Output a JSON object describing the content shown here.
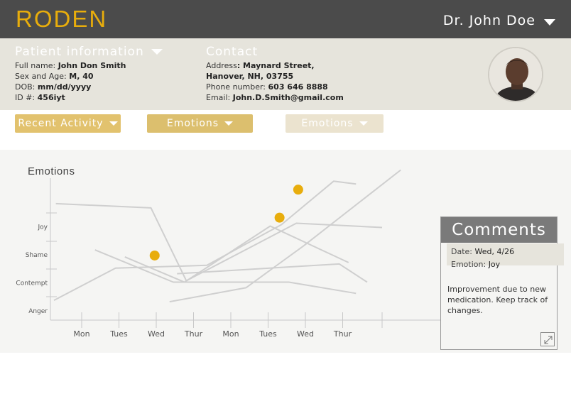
{
  "header": {
    "logo": "RODEN",
    "user_name": "Dr. John Doe"
  },
  "patient": {
    "section_title": "Patient information",
    "full_name_label": "Full name:",
    "full_name": "John Don Smith",
    "sex_age_label": "Sex and Age:",
    "sex_age": "M, 40",
    "dob_label": "DOB:",
    "dob": "mm/dd/yyyy",
    "id_label": "ID #:",
    "id": "456iyt"
  },
  "contact": {
    "section_title": "Contact",
    "address_label": "Address",
    "address_line1": ": Maynard Street,",
    "address_line2": "Hanover, NH, 03755",
    "phone_label": "Phone number:",
    "phone": "603 646 8888",
    "email_label": "Email:",
    "email": "John.D.Smith@gmail.com"
  },
  "filters": [
    {
      "label": "Recent Activity"
    },
    {
      "label": "Emotions"
    },
    {
      "label": "Emotions"
    }
  ],
  "comments": {
    "title": "Comments",
    "date_label": "Date:",
    "date": "Wed, 4/26",
    "emotion_label": "Emotion:",
    "emotion": "Joy",
    "text": "Improvement due to new medication. Keep track of changes."
  },
  "colors": {
    "accent": "#e8ad0c",
    "header_bg": "#4b4b4b",
    "info_bg": "#e6e4dc",
    "line": "#cfcfcf"
  },
  "chart_data": {
    "type": "line",
    "title": "Emotions",
    "x_ticks": [
      "Mon",
      "Tues",
      "Wed",
      "Thur",
      "Mon",
      "Tues",
      "Wed",
      "Thur"
    ],
    "y_ticks": [
      "Anger",
      "Contempt",
      "Shame",
      "Joy"
    ],
    "series": [
      {
        "values": [
          [
            -0.75,
            3.8
          ],
          [
            1.8,
            3.65
          ],
          [
            2.75,
            1.05
          ],
          [
            5.7,
            3.1
          ],
          [
            8.0,
            2.95
          ]
        ]
      },
      {
        "values": [
          [
            0.3,
            2.15
          ],
          [
            2.4,
            1.0
          ],
          [
            5.5,
            1.0
          ],
          [
            7.3,
            0.6
          ]
        ]
      },
      {
        "values": [
          [
            -0.8,
            0.35
          ],
          [
            0.85,
            1.5
          ],
          [
            3.3,
            1.6
          ],
          [
            5.3,
            3.05
          ],
          [
            6.7,
            4.6
          ],
          [
            7.3,
            4.5
          ]
        ]
      },
      {
        "values": [
          [
            2.3,
            0.3
          ],
          [
            4.35,
            0.8
          ],
          [
            5.9,
            2.3
          ],
          [
            8.5,
            5.0
          ]
        ]
      },
      {
        "values": [
          [
            1.1,
            1.9
          ],
          [
            2.7,
            1.0
          ],
          [
            5.0,
            3.0
          ],
          [
            7.1,
            1.7
          ]
        ]
      },
      {
        "values": [
          [
            2.5,
            1.3
          ],
          [
            6.85,
            1.65
          ],
          [
            7.6,
            1.0
          ]
        ]
      }
    ],
    "highlights": [
      [
        1.9,
        1.95
      ],
      [
        5.75,
        4.3
      ],
      [
        5.25,
        3.3
      ]
    ],
    "xlim": [
      -1.0,
      10.2
    ],
    "ylim": [
      -0.35,
      5.1
    ],
    "grid": false
  }
}
